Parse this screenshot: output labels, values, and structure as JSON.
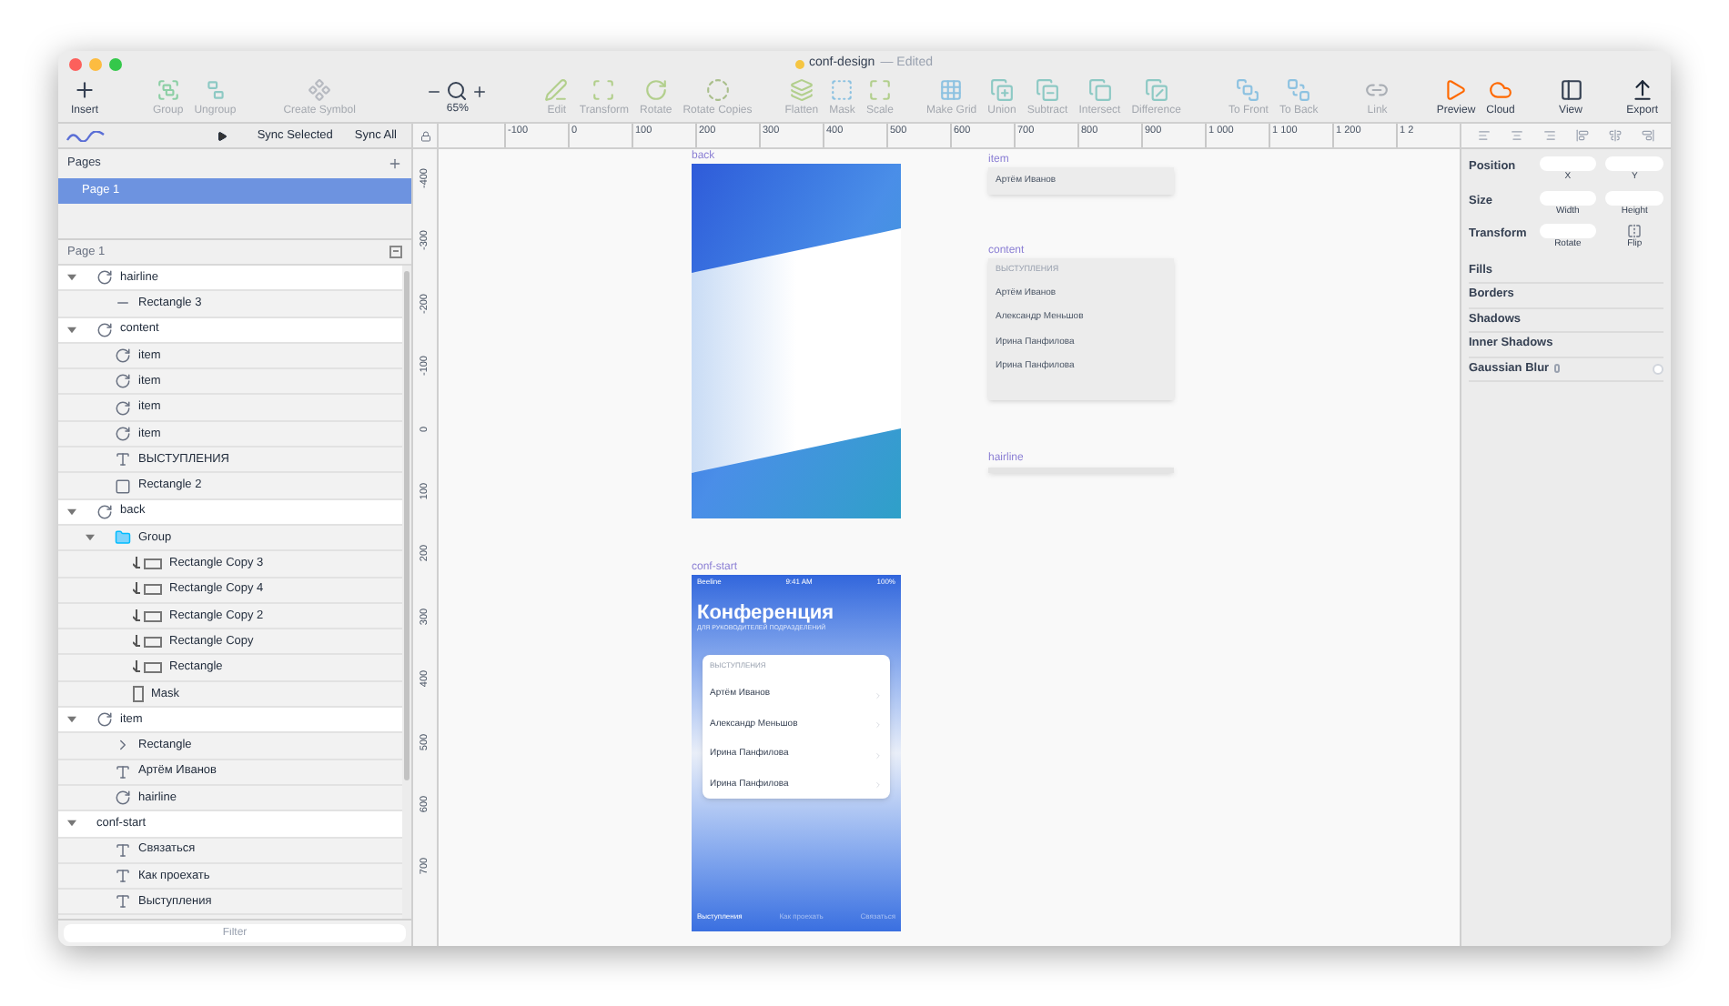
{
  "window": {
    "title": "conf-design",
    "subtitle": "— Edited"
  },
  "toolbar": [
    {
      "kind": "insert",
      "label": "Insert",
      "disabled": false
    },
    {
      "kind": "group",
      "label": "Group",
      "disabled": true
    },
    {
      "kind": "ungroup",
      "label": "Ungroup",
      "disabled": true
    },
    {
      "kind": "symbol",
      "label": "Create Symbol",
      "disabled": true
    },
    {
      "kind": "zoom",
      "label": "65%",
      "disabled": false
    },
    {
      "kind": "edit",
      "label": "Edit",
      "disabled": true
    },
    {
      "kind": "transform",
      "label": "Transform",
      "disabled": true
    },
    {
      "kind": "rotate",
      "label": "Rotate",
      "disabled": true
    },
    {
      "kind": "copies",
      "label": "Rotate Copies",
      "disabled": true
    },
    {
      "kind": "flatten",
      "label": "Flatten",
      "disabled": true
    },
    {
      "kind": "mask",
      "label": "Mask",
      "disabled": true
    },
    {
      "kind": "scale",
      "label": "Scale",
      "disabled": true
    },
    {
      "kind": "grid",
      "label": "Make Grid",
      "disabled": true
    },
    {
      "kind": "union",
      "label": "Union",
      "disabled": true
    },
    {
      "kind": "subtract",
      "label": "Subtract",
      "disabled": true
    },
    {
      "kind": "intersect",
      "label": "Intersect",
      "disabled": true
    },
    {
      "kind": "difference",
      "label": "Difference",
      "disabled": true
    },
    {
      "kind": "front",
      "label": "To Front",
      "disabled": true
    },
    {
      "kind": "back",
      "label": "To Back",
      "disabled": true
    },
    {
      "kind": "link",
      "label": "Link",
      "disabled": true
    },
    {
      "kind": "preview",
      "label": "Preview",
      "disabled": false
    },
    {
      "kind": "cloud",
      "label": "Cloud",
      "disabled": false
    },
    {
      "kind": "view",
      "label": "View",
      "disabled": false
    },
    {
      "kind": "export",
      "label": "Export",
      "disabled": false
    }
  ],
  "sync": {
    "buttons": [
      "Sync Selected",
      "Sync All"
    ]
  },
  "pages": {
    "title": "Pages",
    "items": [
      {
        "label": "Page 1",
        "selected": true
      }
    ]
  },
  "layers": {
    "title": "Page 1",
    "items": [
      {
        "name": "hairline",
        "kind": "symbol",
        "expanded": true,
        "children": [
          {
            "name": "Rectangle 3",
            "kind": "line"
          }
        ]
      },
      {
        "name": "content",
        "kind": "symbol",
        "expanded": true,
        "children": [
          {
            "name": "item",
            "kind": "symbol"
          },
          {
            "name": "item",
            "kind": "symbol"
          },
          {
            "name": "item",
            "kind": "symbol"
          },
          {
            "name": "item",
            "kind": "symbol"
          },
          {
            "name": "ВЫСТУПЛЕНИЯ",
            "kind": "text"
          },
          {
            "name": "Rectangle 2",
            "kind": "rect"
          }
        ]
      },
      {
        "name": "back",
        "kind": "symbol",
        "expanded": true,
        "children": [
          {
            "name": "Group",
            "kind": "folder",
            "expanded": true,
            "children": [
              {
                "name": "Rectangle Copy 3",
                "kind": "masked"
              },
              {
                "name": "Rectangle Copy 4",
                "kind": "masked"
              },
              {
                "name": "Rectangle Copy 2",
                "kind": "masked"
              },
              {
                "name": "Rectangle Copy",
                "kind": "masked"
              },
              {
                "name": "Rectangle",
                "kind": "masked"
              },
              {
                "name": "Mask",
                "kind": "mask"
              }
            ]
          }
        ]
      },
      {
        "name": "item",
        "kind": "symbol",
        "expanded": true,
        "children": [
          {
            "name": "Rectangle",
            "kind": "chevron"
          },
          {
            "name": "Артём Иванов",
            "kind": "text"
          },
          {
            "name": "hairline",
            "kind": "symbol"
          }
        ]
      },
      {
        "name": "conf-start",
        "kind": "artboard",
        "expanded": true,
        "children": [
          {
            "name": "Связаться",
            "kind": "text"
          },
          {
            "name": "Как проехать",
            "kind": "text"
          },
          {
            "name": "Выступления",
            "kind": "text"
          }
        ]
      }
    ]
  },
  "filter": {
    "placeholder": "Filter"
  },
  "ruler": {
    "horizontal": [
      "-100",
      "0",
      "100",
      "200",
      "300",
      "400",
      "500",
      "600",
      "700",
      "800",
      "900",
      "1 000",
      "1 100",
      "1 200",
      "1 2"
    ],
    "vertical": [
      "-400",
      "-300",
      "-200",
      "-100",
      "0",
      "100",
      "200",
      "300",
      "400",
      "500",
      "600",
      "700"
    ]
  },
  "artboards": [
    {
      "kind": "gradient",
      "title": "back"
    },
    {
      "kind": "item",
      "title": "item",
      "name": "Артём Иванов"
    },
    {
      "kind": "list",
      "title": "content",
      "heading": "ВЫСТУПЛЕНИЯ",
      "names": [
        "Артём Иванов",
        "Александр Меньшов",
        "Ирина Панфилова",
        "Ирина Панфилова"
      ]
    },
    {
      "kind": "hairline",
      "title": "hairline"
    },
    {
      "kind": "phone",
      "title": "conf-start",
      "status": [
        "Beeline",
        "9:41 AM",
        "100%"
      ],
      "heading": "Конференция",
      "subtitle": "ДЛЯ РУКОВОДИТЕЛЕЙ ПОДРАЗДЕЛЕНИЙ",
      "card_heading": "ВЫСТУПЛЕНИЯ",
      "names": [
        "Артём Иванов",
        "Александр Меньшов",
        "Ирина Панфилова",
        "Ирина Панфилова"
      ],
      "tabs": [
        {
          "label": "Выступления",
          "selected": true
        },
        {
          "label": "Как проехать",
          "selected": false
        },
        {
          "label": "Связаться",
          "selected": false
        }
      ]
    }
  ],
  "inspector": {
    "rows": [
      {
        "label": "Position",
        "fields": [
          {
            "kind": "input",
            "label": "X"
          },
          {
            "kind": "input",
            "label": "Y"
          }
        ]
      },
      {
        "label": "Size",
        "fields": [
          {
            "kind": "input",
            "label": "Width"
          },
          {
            "kind": "input",
            "label": "Height"
          }
        ]
      },
      {
        "label": "Transform",
        "fields": [
          {
            "kind": "input",
            "label": "Rotate"
          },
          {
            "kind": "flip",
            "label": "Flip"
          }
        ]
      }
    ],
    "sections": [
      {
        "label": "Fills",
        "kind": "plain"
      },
      {
        "label": "Borders",
        "kind": "plain"
      },
      {
        "label": "Shadows",
        "kind": "plain"
      },
      {
        "label": "Inner Shadows",
        "kind": "plain"
      },
      {
        "label": "Gaussian Blur",
        "kind": "blur",
        "checked": false
      }
    ]
  }
}
